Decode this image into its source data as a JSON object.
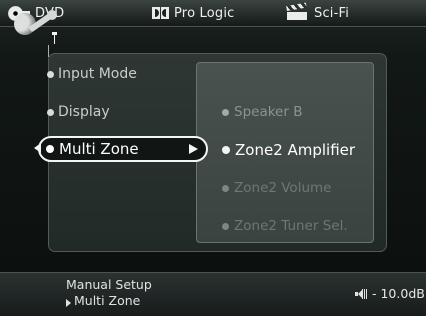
{
  "header": {
    "source": "DVD",
    "source_icon": "disc-icon",
    "surround_mode": "Pro Logic",
    "surround_icon": "dolby-icon",
    "preset": "Sci-Fi",
    "preset_icon": "clapper-icon"
  },
  "menu": {
    "left_items": [
      {
        "label": "Input Mode"
      },
      {
        "label": "Display"
      },
      {
        "label": "Multi Zone",
        "selected": true
      }
    ],
    "sub_items": [
      {
        "label": "Speaker B",
        "state": "normal"
      },
      {
        "label": "Zone2 Amplifier",
        "state": "active"
      },
      {
        "label": "Zone2 Volume",
        "state": "dim"
      },
      {
        "label": "Zone2 Tuner Sel.",
        "state": "dim"
      }
    ]
  },
  "footer": {
    "breadcrumb_title": "Manual Setup",
    "breadcrumb_sub": "Multi Zone",
    "volume": "- 10.0dB",
    "footer_icon": "wrench-icon",
    "volume_icon": "volume-icon"
  },
  "colors": {
    "background": "#0b0f0e",
    "panel": "#2f3735",
    "subpanel": "#4a5250",
    "active_text": "#ffffff",
    "dim_text": "#6f7775"
  }
}
